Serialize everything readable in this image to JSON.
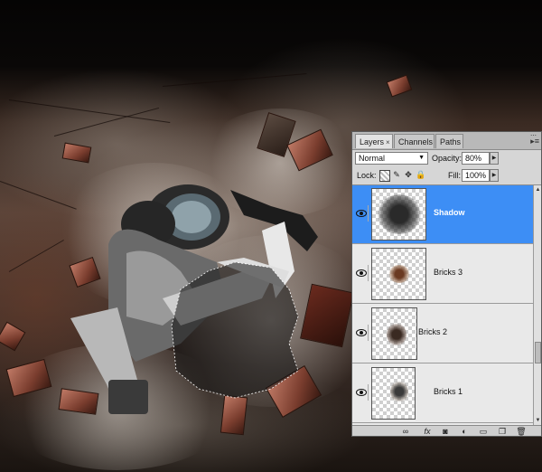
{
  "panel": {
    "tabs": [
      {
        "label": "Layers",
        "close": "×",
        "active": true
      },
      {
        "label": "Channels",
        "active": false
      },
      {
        "label": "Paths",
        "active": false
      }
    ],
    "menu_icon": "▸≡",
    "blend_mode": "Normal",
    "opacity_label": "Opacity:",
    "opacity_value": "80%",
    "lock_label": "Lock:",
    "fill_label": "Fill:",
    "fill_value": "100%",
    "lock_icons": [
      "lock-transparent-icon",
      "lock-paint-icon",
      "lock-move-icon",
      "lock-all-icon"
    ],
    "layers": [
      {
        "name": "Shadow",
        "selected": true,
        "visible": true
      },
      {
        "name": "Bricks 3",
        "selected": false,
        "visible": true
      },
      {
        "name": "Bricks 2",
        "selected": false,
        "visible": true
      },
      {
        "name": "Bricks 1",
        "selected": false,
        "visible": true
      }
    ],
    "footer_icons": [
      "link-layers-icon",
      "fx-icon",
      "layer-mask-icon",
      "adjustment-layer-icon",
      "new-group-icon",
      "new-layer-icon",
      "trash-icon"
    ],
    "footer_glyphs": {
      "link": "∞",
      "fx": "fx",
      "mask": "◙",
      "adjust": "◐",
      "group": "▭",
      "new": "❐",
      "trash": "🗑"
    }
  },
  "colors": {
    "selection": "#3d8ef5",
    "panel_bg": "#d6d6d6"
  }
}
